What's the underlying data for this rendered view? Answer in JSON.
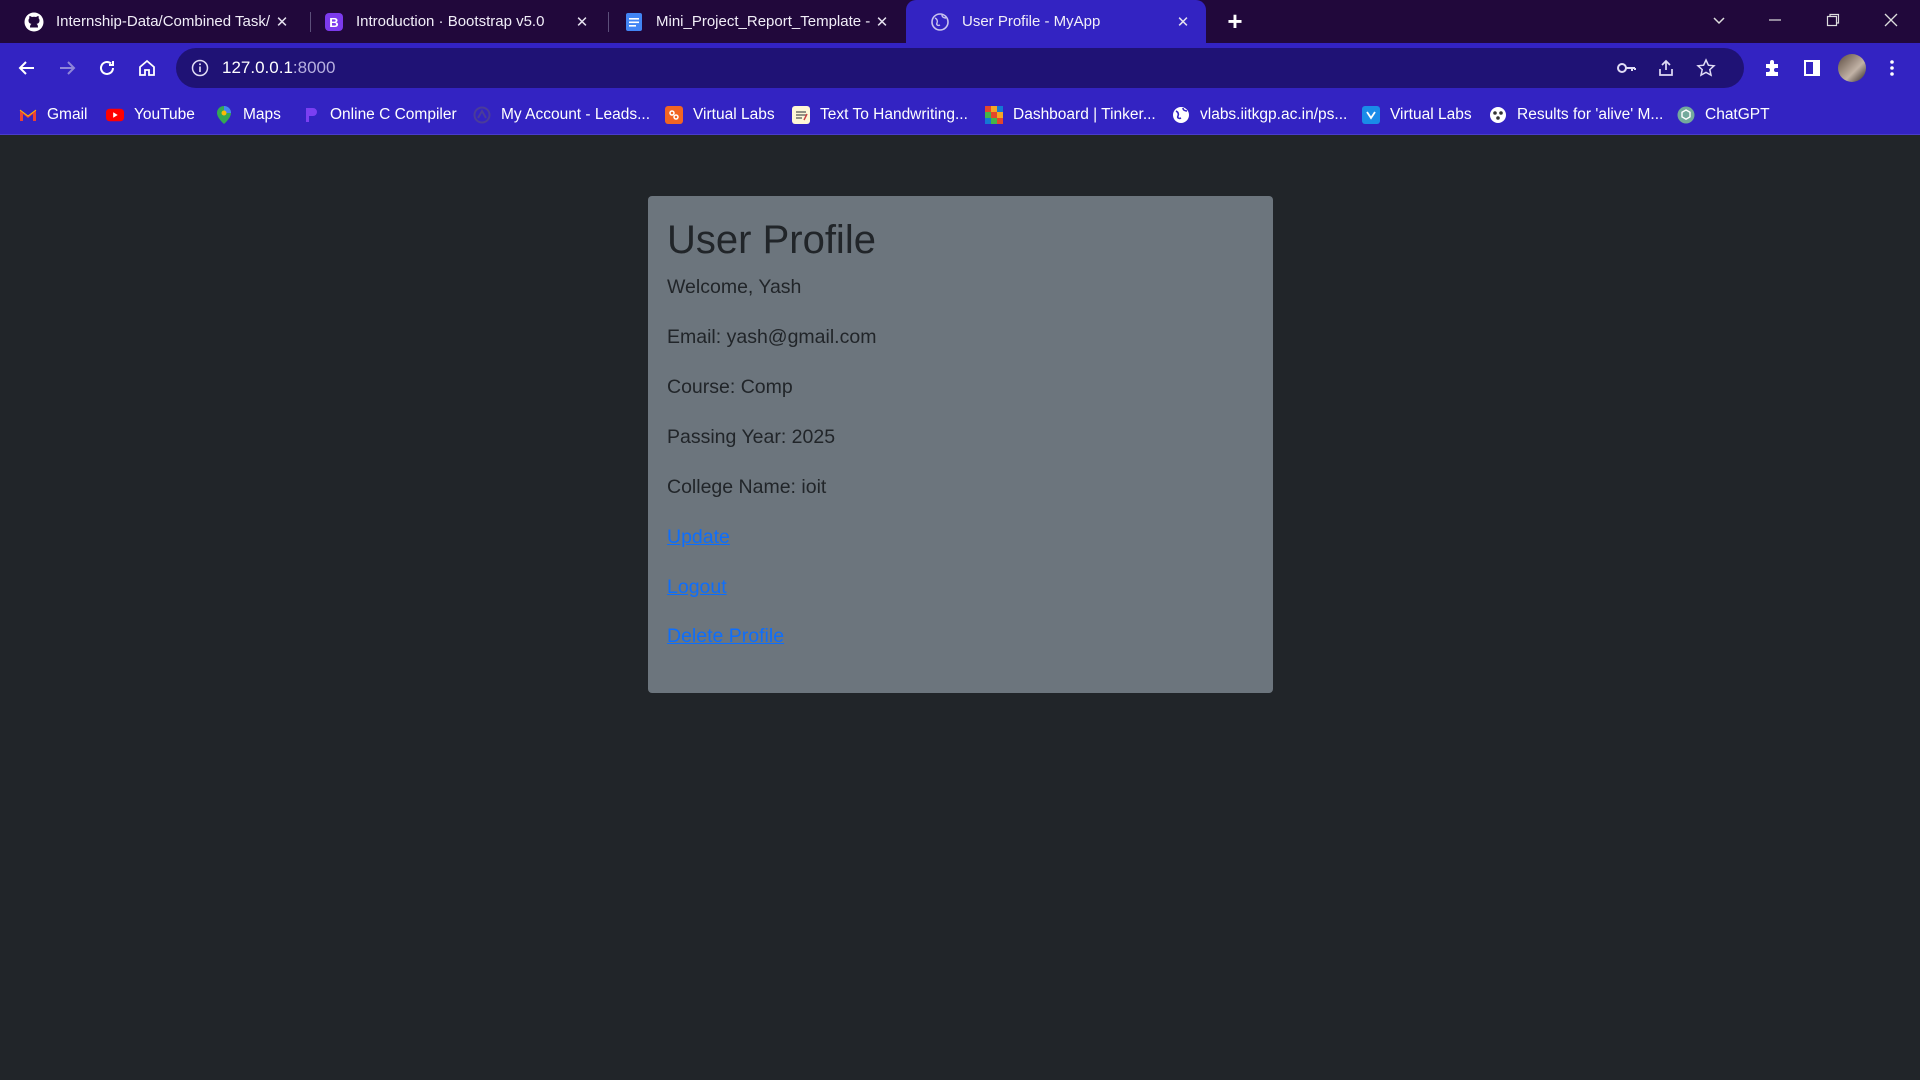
{
  "browser": {
    "tabs": [
      {
        "title": "Internship-Data/Combined Task/",
        "icon": "github-icon"
      },
      {
        "title": "Introduction · Bootstrap v5.0",
        "icon": "bootstrap-icon"
      },
      {
        "title": "Mini_Project_Report_Template -",
        "icon": "google-docs-icon"
      },
      {
        "title": "User Profile - MyApp",
        "icon": "globe-icon",
        "active": true
      }
    ],
    "close_glyph": "✕",
    "new_tab_glyph": "+",
    "url_host": "127.0.0.1",
    "url_port": ":8000",
    "bookmarks": [
      {
        "label": "Gmail",
        "icon": "gmail-icon"
      },
      {
        "label": "YouTube",
        "icon": "youtube-icon"
      },
      {
        "label": "Maps",
        "icon": "maps-icon"
      },
      {
        "label": "Online C Compiler",
        "icon": "compiler-icon"
      },
      {
        "label": "My Account - Leads...",
        "icon": "leads-icon"
      },
      {
        "label": "Virtual Labs",
        "icon": "virtual-labs-icon"
      },
      {
        "label": "Text To Handwriting...",
        "icon": "handwriting-icon"
      },
      {
        "label": "Dashboard | Tinker...",
        "icon": "tinkercad-icon"
      },
      {
        "label": "vlabs.iitkgp.ac.in/ps...",
        "icon": "globe-icon"
      },
      {
        "label": "Virtual Labs",
        "icon": "virtual-labs-icon"
      },
      {
        "label": "Results for 'alive' M...",
        "icon": "results-icon"
      },
      {
        "label": "ChatGPT",
        "icon": "chatgpt-icon"
      }
    ],
    "colors": {
      "tabstrip": "#21083b",
      "toolbar": "#3323c2",
      "omnibox": "#1f1275"
    }
  },
  "profile": {
    "heading": "User Profile",
    "welcome": "Welcome, Yash",
    "email": "Email: yash@gmail.com",
    "course": "Course: Comp",
    "passing_year": "Passing Year: 2025",
    "college": "College Name: ioit",
    "links": {
      "update": "Update",
      "logout": "Logout",
      "delete": "Delete Profile"
    },
    "colors": {
      "page_bg": "#212529",
      "card_bg": "#6c757d",
      "link": "#0d6efd"
    }
  }
}
